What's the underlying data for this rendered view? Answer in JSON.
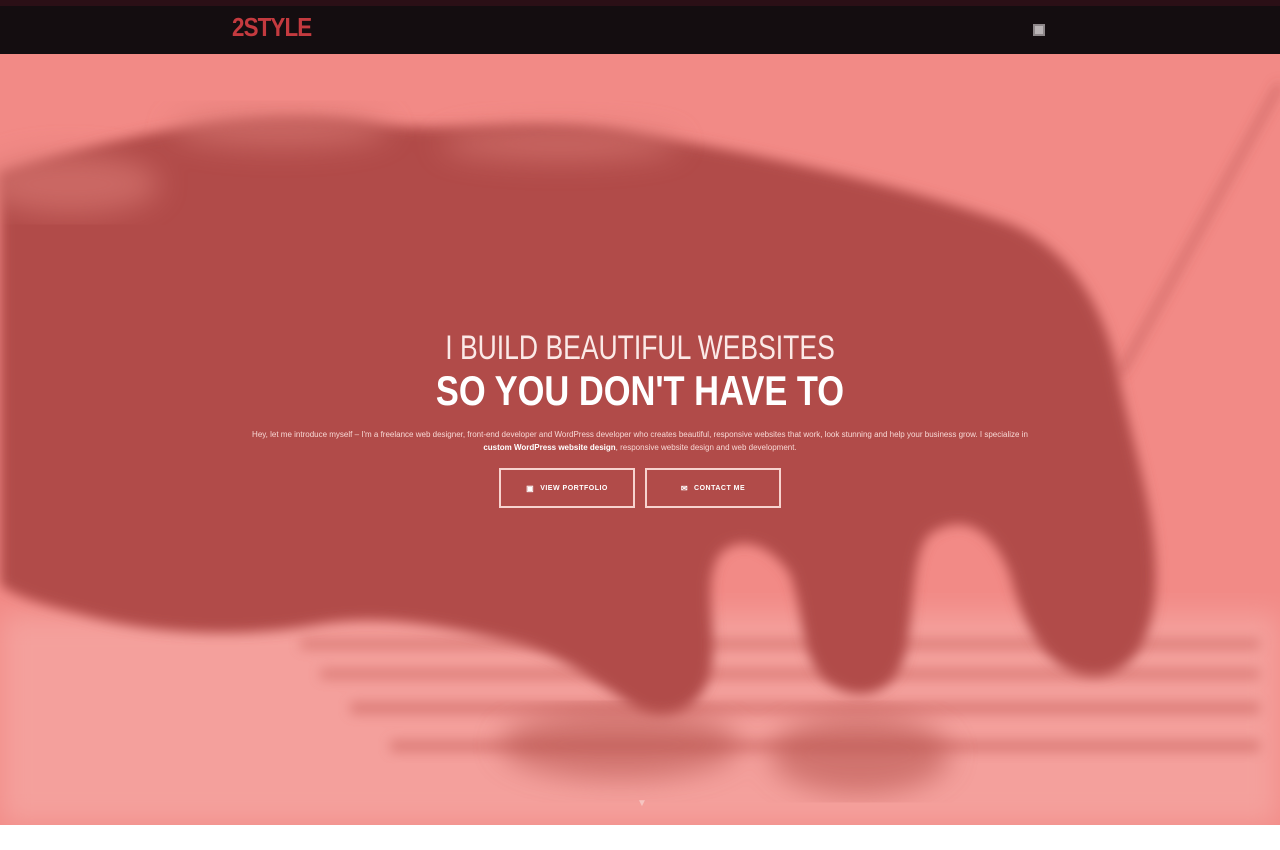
{
  "header": {
    "logo_text": "2STYLE",
    "menu_icon": "hamburger-menu-icon"
  },
  "hero": {
    "headline_line1": "I BUILD BEAUTIFUL WEBSITES",
    "headline_line2": "SO YOU DON'T HAVE TO",
    "intro_part1": "Hey, let me introduce myself – I'm a freelance web designer, front-end developer and WordPress developer who creates beautiful, responsive websites that",
    "intro_part2": "work, look stunning and help your business grow. I specialize in",
    "intro_bold": "custom WordPress website design",
    "intro_part3": ", responsive website design and web development.",
    "buttons": [
      {
        "icon": "portfolio-icon",
        "label": "VIEW PORTFOLIO"
      },
      {
        "icon": "contact-icon",
        "label": "CONTACT ME"
      }
    ],
    "scroll_icon": "chevron-down-icon"
  },
  "colors": {
    "nav_bg": "#140d10",
    "logo": "#c43a3f",
    "hero_light": "#f28a86",
    "hero_dark": "#b04a47"
  }
}
